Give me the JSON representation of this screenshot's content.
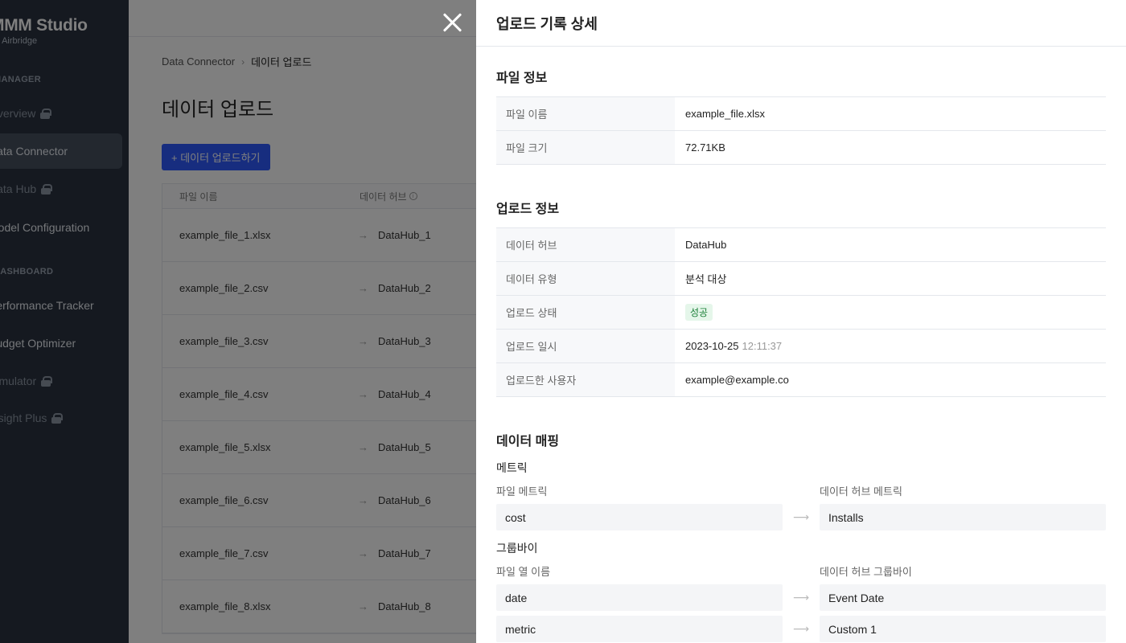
{
  "sidebar": {
    "brand_name": "MMM Studio",
    "brand_sub": "by Airbridge",
    "section_manager": "MANAGER",
    "section_dashboard": "DASHBOARD",
    "items": [
      {
        "label": "Overview",
        "locked": true
      },
      {
        "label": "Data Connector",
        "locked": false,
        "active": true
      },
      {
        "label": "Data Hub",
        "locked": true
      },
      {
        "label": "Model Configuration",
        "locked": false
      },
      {
        "label": "Performance Tracker",
        "locked": false
      },
      {
        "label": "Budget Optimizer",
        "locked": false
      },
      {
        "label": "Simulator",
        "locked": true
      },
      {
        "label": "Insight Plus",
        "locked": true
      }
    ]
  },
  "main": {
    "breadcrumb_root": "Data Connector",
    "breadcrumb_sep": "›",
    "breadcrumb_current": "데이터 업로드",
    "page_title": "데이터 업로드",
    "upload_button": "+ 데이터 업로드하기",
    "table": {
      "col_file": "파일 이름",
      "col_hub": "데이터 허브",
      "rows": [
        {
          "file": "example_file_1.xlsx",
          "hub": "DataHub_1"
        },
        {
          "file": "example_file_2.csv",
          "hub": "DataHub_2"
        },
        {
          "file": "example_file_3.csv",
          "hub": "DataHub_3"
        },
        {
          "file": "example_file_4.csv",
          "hub": "DataHub_4"
        },
        {
          "file": "example_file_5.xlsx",
          "hub": "DataHub_5"
        },
        {
          "file": "example_file_6.csv",
          "hub": "DataHub_6"
        },
        {
          "file": "example_file_7.csv",
          "hub": "DataHub_7"
        },
        {
          "file": "example_file_8.xlsx",
          "hub": "DataHub_8"
        }
      ]
    }
  },
  "drawer": {
    "title": "업로드 기록 상세",
    "file_info": {
      "title": "파일 정보",
      "name_label": "파일 이름",
      "name_value": "example_file.xlsx",
      "size_label": "파일 크기",
      "size_value": "72.71KB"
    },
    "upload_info": {
      "title": "업로드 정보",
      "hub_label": "데이터 허브",
      "hub_value": "DataHub",
      "type_label": "데이터 유형",
      "type_value": "분석 대상",
      "status_label": "업로드 상태",
      "status_value": "성공",
      "date_label": "업로드 일시",
      "date_value": "2023-10-25",
      "time_value": "12:11:37",
      "user_label": "업로드한 사용자",
      "user_value": "example@example.co"
    },
    "mapping": {
      "title": "데이터 매핑",
      "metric_title": "메트릭",
      "metric_left_label": "파일 메트릭",
      "metric_right_label": "데이터 허브 메트릭",
      "metrics": [
        {
          "from": "cost",
          "to": "Installs"
        }
      ],
      "groupby_title": "그룹바이",
      "groupby_left_label": "파일 열 이름",
      "groupby_right_label": "데이터 허브 그룹바이",
      "groupbys": [
        {
          "from": "date",
          "to": "Event Date"
        },
        {
          "from": "metric",
          "to": "Custom 1"
        },
        {
          "from": "",
          "to": ""
        }
      ]
    }
  }
}
